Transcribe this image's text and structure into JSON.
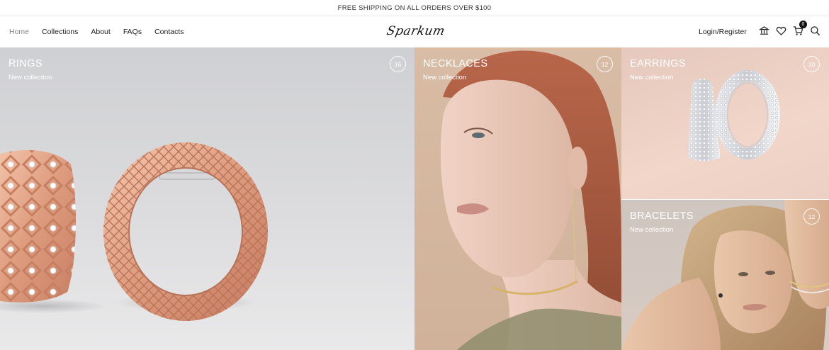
{
  "topbar": {
    "text": "FREE SHIPPING ON ALL ORDERS OVER $100"
  },
  "nav": {
    "items": [
      {
        "label": "Home"
      },
      {
        "label": "Collections"
      },
      {
        "label": "About"
      },
      {
        "label": "FAQs"
      },
      {
        "label": "Contacts"
      }
    ],
    "active": "Home"
  },
  "logo": {
    "text": "Sparkum"
  },
  "account": {
    "login_label": "Login/Register"
  },
  "icons": [
    "currency-icon",
    "heart-icon",
    "cart-icon",
    "search-icon"
  ],
  "cart": {
    "count": "0"
  },
  "categories": [
    {
      "title": "RINGS",
      "subtitle": "New collection",
      "count": "16"
    },
    {
      "title": "NECKLACES",
      "subtitle": "New collection",
      "count": "12"
    },
    {
      "title": "EARRINGS",
      "subtitle": "New collection",
      "count": "10"
    },
    {
      "title": "BRACELETS",
      "subtitle": "New collection",
      "count": "12"
    }
  ],
  "colors": {
    "accent": "#111111",
    "rose_gold": "#e3a084",
    "text": "#222222"
  }
}
